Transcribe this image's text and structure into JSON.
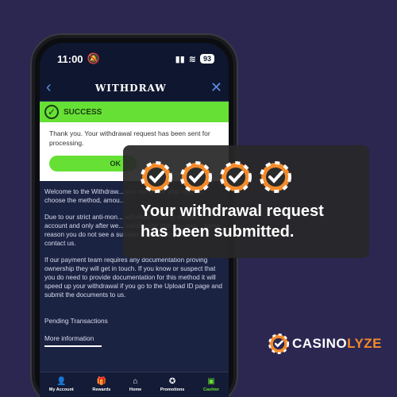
{
  "status_bar": {
    "time": "11:00",
    "battery": "93"
  },
  "header": {
    "title": "WITHDRAW"
  },
  "success": {
    "label": "SUCCESS",
    "message": "Thank you. Your withdrawal request has been sent for processing.",
    "ok_label": "OK"
  },
  "body": {
    "para1": "Welcome to the Withdraw... you can place your reques... choose the method, amou...",
    "para2": "Due to our strict anti-mon... withdraw funds to a meth... account and only after we... satisfaction that you own... some reason you do not see a suitable method for you please contact us.",
    "para3": "If our payment team requires any documentation proving ownership they will get in touch. If you know or suspect that you do need to provide documentation for this method it will speed up your withdrawal if you go to the Upload ID page and submit the documents to us."
  },
  "links": {
    "pending": "Pending Transactions",
    "more_info": "More information"
  },
  "tabs": [
    {
      "label": "My Account",
      "icon": "person-icon"
    },
    {
      "label": "Rewards",
      "icon": "gift-icon"
    },
    {
      "label": "Home",
      "icon": "home-icon"
    },
    {
      "label": "Promotions",
      "icon": "medal-icon"
    },
    {
      "label": "Cashier",
      "icon": "cash-icon"
    }
  ],
  "overlay": {
    "message_line1": "Your withdrawal request",
    "message_line2": "has been submitted."
  },
  "brand": {
    "part1": "CASINO",
    "part2": "LYZE"
  },
  "colors": {
    "accent_green": "#66e034",
    "brand_orange": "#f28a2a",
    "background": "#2b2751"
  }
}
